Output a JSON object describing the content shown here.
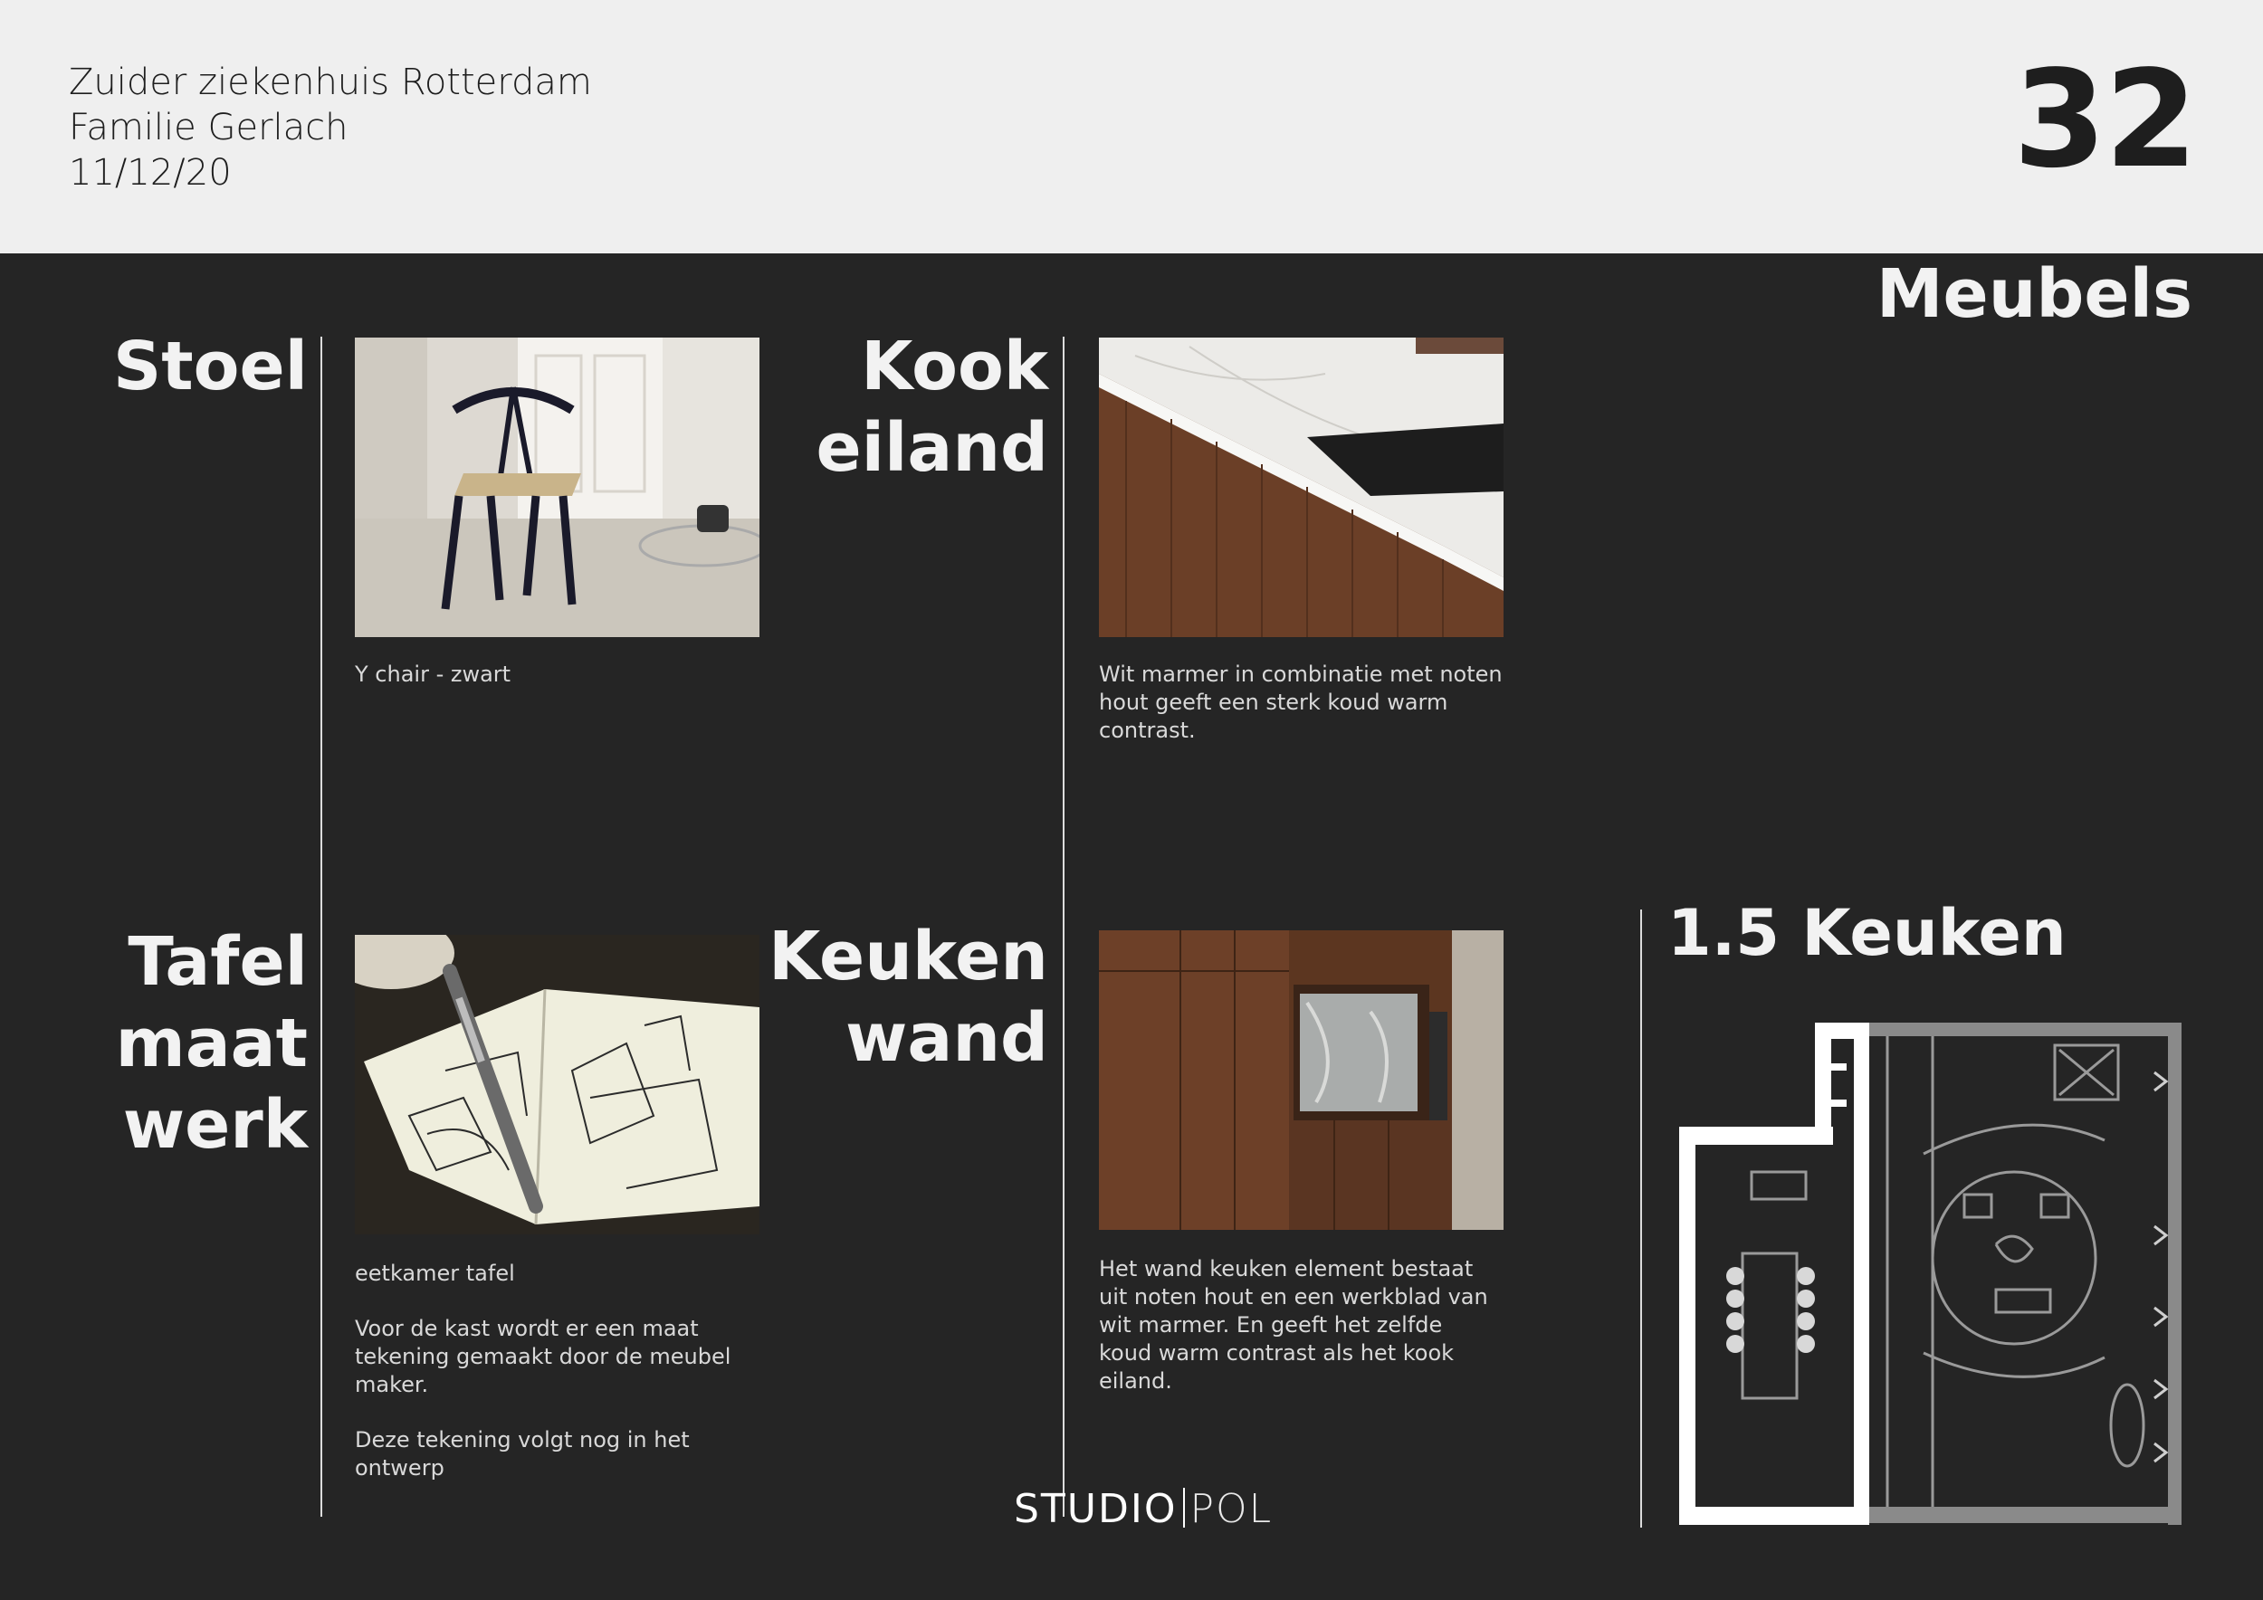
{
  "header": {
    "project": "Zuider ziekenhuis Rotterdam",
    "client": "Familie Gerlach",
    "date": "11/12/20",
    "page_number": "32"
  },
  "section_title": "Meubels",
  "items": {
    "stoel": {
      "label_lines": [
        "Stoel"
      ],
      "image": "chair-photo",
      "captions": [
        "Y chair - zwart"
      ]
    },
    "kookeiland": {
      "label_lines": [
        "Kook",
        "eiland"
      ],
      "image": "marble-kitchen-island-photo",
      "captions": [
        "Wit marmer in combinatie met noten hout geeft een sterk koud warm contrast."
      ]
    },
    "tafel": {
      "label_lines": [
        "Tafel",
        "maat",
        "werk"
      ],
      "image": "sketchbook-photo",
      "captions": [
        "eetkamer tafel",
        "Voor de kast wordt er een maat tekening gemaakt door de meubel maker.",
        "Deze tekening volgt nog in het ontwerp"
      ]
    },
    "keukenwand": {
      "label_lines": [
        "Keuken",
        "wand"
      ],
      "image": "walnut-kitchen-wall-photo",
      "captions": [
        "Het wand keuken element bestaat uit noten hout en een werkblad van wit marmer. En geeft het zelfde koud warm contrast als het kook eiland."
      ]
    }
  },
  "plan": {
    "title": "1.5 Keuken",
    "image": "floor-plan-drawing"
  },
  "logo": {
    "part1": "STUDIO",
    "part2": "POL"
  },
  "colors": {
    "background": "#252525",
    "header_background": "#efefef",
    "text_light": "#f2f2f2",
    "text_dark": "#1e1e1e"
  }
}
